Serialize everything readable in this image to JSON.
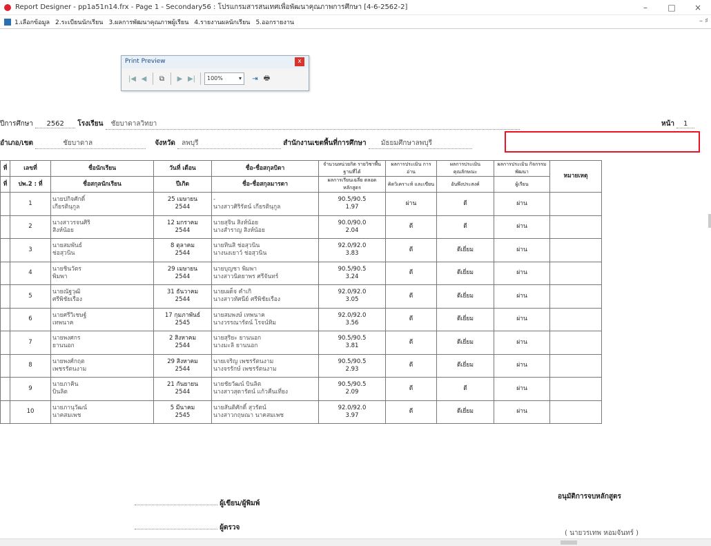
{
  "window": {
    "title": "Report Designer - pp1a51n14.frx - Page 1 - Secondary56 : โปรแกรมสารสนเทศเพื่อพัฒนาคุณภาพการศึกษา [4-6-2562-2]",
    "min": "–",
    "max": "□",
    "close": "×"
  },
  "menu": {
    "items": [
      "1.เลือกข้อมูล",
      "2.ระเบียนนักเรียน",
      "3.ผลการพัฒนาคุณภาพผู้เรียน",
      "4.รายงานผลนักเรียน",
      "5.ออกรายงาน"
    ],
    "right": "– ♯"
  },
  "print_preview": {
    "title": "Print Preview",
    "close": "x",
    "tools": [
      "|◀",
      "◀",
      "⧉",
      "▶",
      "▶|"
    ],
    "zoom": "100%",
    "zoom_arrow": "▾",
    "exit": "⇥",
    "print": "🖶"
  },
  "header": {
    "year_label": "ปีการศึกษา",
    "year": "2562",
    "school_label": "โรงเรียน",
    "school": "ชัยบาดาลวิทยา",
    "page_label": "หน้า",
    "page": "1",
    "district_label": "อำเภอ/เขต",
    "district": "ชัยบาดาล",
    "province_label": "จังหวัด",
    "province": "ลพบุรี",
    "office_label": "สำนักงานเขตพื้นที่การศึกษา",
    "office": "มัธยมศึกษาลพบุรี"
  },
  "table": {
    "head1": [
      "ที่",
      "เลขที่",
      "ชื่อนักเรียน",
      "วันที่ เดือน",
      "ชื่อ-ชื่อสกุลบิดา",
      "จำนวนหน่วยกิต รายวิชาพื้นฐานที่ได้",
      "ผลการประเมิน การอ่าน",
      "ผลการประเมิน คุณลักษณะ",
      "ผลการประเมิน กิจกรรมพัฒนา",
      "หมายเหตุ"
    ],
    "head2": [
      "ที่",
      "ปพ.2 : ที่",
      "ชื่อสกุลนักเรียน",
      "ปีเกิด",
      "ชื่อ-ชื่อสกุลมารดา",
      "ผลการเรียนเฉลี่ย ตลอดหลักสูตร",
      "คิดวิเคราะห์ และเขียน",
      "อันพึงประสงค์",
      "ผู้เรียน"
    ],
    "rows": [
      {
        "no": "1",
        "name": "นายปกิจศักดิ์",
        "surname": "เกียรตินุกูล",
        "date": "25 เมษายน",
        "year": "2544",
        "father": "-",
        "mother": "นางสาวศิริรัตน์ เกียรตินุกูล",
        "credit": "90.5/90.5",
        "gpa": "1.97",
        "read": "ผ่าน",
        "trait": "ดี",
        "act": "ผ่าน"
      },
      {
        "no": "2",
        "name": "นางสาวรจนศิริ",
        "surname": "สิงห์น้อย",
        "date": "12 มกราคม",
        "year": "2544",
        "father": "นายสุจิน สิงห์น้อย",
        "mother": "นางสำราญ สิงห์น้อย",
        "credit": "90.0/90.0",
        "gpa": "2.04",
        "read": "ดี",
        "trait": "ดี",
        "act": "ผ่าน"
      },
      {
        "no": "3",
        "name": "นายสมพันธ์",
        "surname": "ช่อสุวนิน",
        "date": "8 ตุลาคม",
        "year": "2544",
        "father": "นายทินสิ ช่อสุวนิน",
        "mother": "นางนงเยาว์ ช่อสุวนิน",
        "credit": "92.0/92.0",
        "gpa": "3.83",
        "read": "ดี",
        "trait": "ดีเยี่ยม",
        "act": "ผ่าน"
      },
      {
        "no": "4",
        "name": "นายชินวัตร",
        "surname": "พิมพา",
        "date": "29 เมษายน",
        "year": "2544",
        "father": "นายบุญชา พิมพา",
        "mother": "นางสาวนิตยาพร ศรีจันทร์",
        "credit": "90.5/90.5",
        "gpa": "3.24",
        "read": "ดี",
        "trait": "ดีเยี่ยม",
        "act": "ผ่าน"
      },
      {
        "no": "5",
        "name": "นายณัฐวุฒิ",
        "surname": "ศรีพิชัยเรือง",
        "date": "31 ธันวาคม",
        "year": "2544",
        "father": "นายเผด็จ คำเกิ",
        "mother": "นางสาวทัศนีย์ ศรีพิชัยเรือง",
        "credit": "92.0/92.0",
        "gpa": "3.05",
        "read": "ดี",
        "trait": "ดีเยี่ยม",
        "act": "ผ่าน"
      },
      {
        "no": "6",
        "name": "นายศรีวิเชษฐ์",
        "surname": "เทพนาค",
        "date": "17 กุมภาพันธ์",
        "year": "2545",
        "father": "นายสมพงษ์ เทพนาค",
        "mother": "นางวรรณารัตน์ โรจน์ทิม",
        "credit": "92.0/92.0",
        "gpa": "3.56",
        "read": "ดี",
        "trait": "ดีเยี่ยม",
        "act": "ผ่าน"
      },
      {
        "no": "7",
        "name": "นายพงศกร",
        "surname": "ยานนอก",
        "date": "2 สิงหาคม",
        "year": "2544",
        "father": "นายสุริยะ ยานนอก",
        "mother": "นางมะลิ ยานนอก",
        "credit": "90.5/90.5",
        "gpa": "3.81",
        "read": "ดี",
        "trait": "ดีเยี่ยม",
        "act": "ผ่าน"
      },
      {
        "no": "8",
        "name": "นายพงศ์กฤต",
        "surname": "เพชรรัตนงาม",
        "date": "29 สิงหาคม",
        "year": "2544",
        "father": "นายเจริญ เพชรรัตนงาม",
        "mother": "นางจรรักษ์ เพชรรัตนงาม",
        "credit": "90.5/90.5",
        "gpa": "2.93",
        "read": "ดี",
        "trait": "ดีเยี่ยม",
        "act": "ผ่าน"
      },
      {
        "no": "9",
        "name": "นายภาคิน",
        "surname": "บินลิต",
        "date": "21 กันยายน",
        "year": "2544",
        "father": "นายชัยวัฒน์ บินลิต",
        "mother": "นางสาวสุดารัตน์ แก้วคืนเที่ยง",
        "credit": "90.5/90.5",
        "gpa": "2.09",
        "read": "ดี",
        "trait": "ดี",
        "act": "ผ่าน"
      },
      {
        "no": "10",
        "name": "นายภานุวัฒน์",
        "surname": "นาคสมเพช",
        "date": "5 มีนาคม",
        "year": "2545",
        "father": "นายสันติศักดิ์ สุวรัตน์",
        "mother": "นางสาวกฤษณา นาคสมเพช",
        "credit": "92.0/92.0",
        "gpa": "3.97",
        "read": "ดี",
        "trait": "ดีเยี่ยม",
        "act": "ผ่าน"
      }
    ]
  },
  "footer": {
    "writer": "ผู้เขียน/ผู้พิมพ์",
    "checker": "ผู้ตรวจ",
    "approver": "อนุมัติการจบหลักสูตร",
    "signer": "( นายวรเทพ หอมจันทร์ )"
  }
}
